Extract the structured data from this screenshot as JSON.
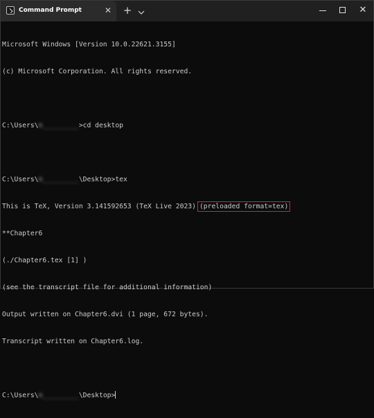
{
  "window": {
    "tab_title": "Command Prompt",
    "tab_close_icon": "close-icon",
    "new_tab_icon": "plus-icon",
    "dropdown_icon": "chevron-down-icon",
    "minimize_icon": "minimize-icon",
    "maximize_icon": "maximize-icon",
    "close_icon": "close-icon"
  },
  "console": {
    "lines": [
      "Microsoft Windows [Version 10.0.22621.3155]",
      "(c) Microsoft Corporation. All rights reserved.",
      "",
      "",
      "",
      "",
      "This is TeX, Version 3.141592653 (TeX Live 2023)",
      "**Chapter6",
      "(./Chapter6.tex [1] )",
      "(see the transcript file for additional information)",
      "Output written on Chapter6.dvi (1 page, 672 bytes).",
      "Transcript written on Chapter6.log.",
      "",
      ""
    ],
    "prompt1_prefix": "C:\\Users\\",
    "prompt1_redacted": "m_________",
    "prompt1_suffix": ">cd desktop",
    "prompt2_prefix": "C:\\Users\\",
    "prompt2_redacted": "m_________",
    "prompt2_suffix": "\\Desktop>tex",
    "highlighted_text": "(preloaded format=tex)",
    "highlight_color": "#e0222b",
    "prompt3_prefix": "C:\\Users\\",
    "prompt3_redacted": "m_________",
    "prompt3_suffix": "\\Desktop>"
  }
}
